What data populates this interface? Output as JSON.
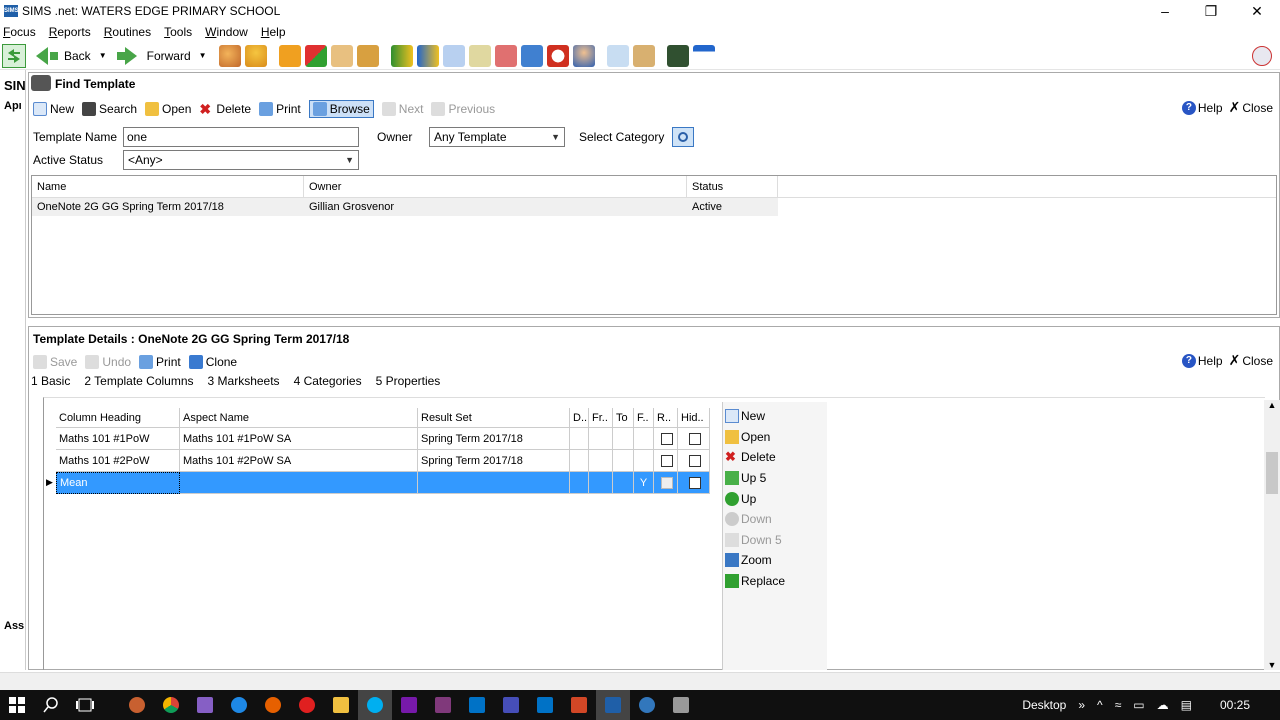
{
  "window": {
    "title": "SIMS .net: WATERS EDGE PRIMARY SCHOOL",
    "icon_text": "SIMS"
  },
  "window_controls": {
    "minimize": "–",
    "restore": "❐",
    "close": "✕"
  },
  "menu": [
    "Focus",
    "Reports",
    "Routines",
    "Tools",
    "Window",
    "Help"
  ],
  "main_toolbar": {
    "back": "Back",
    "forward": "Forward"
  },
  "left_strip": {
    "a": "SIN",
    "b": "Apı",
    "c": "Ass"
  },
  "find_template": {
    "title": "Find Template",
    "toolbar": {
      "new": "New",
      "search": "Search",
      "open": "Open",
      "delete": "Delete",
      "print": "Print",
      "browse": "Browse",
      "next": "Next",
      "previous": "Previous"
    },
    "help": "Help",
    "close": "Close",
    "template_name_label": "Template Name",
    "template_name_value": "one",
    "owner_label": "Owner",
    "owner_value": "Any Template",
    "select_category_label": "Select Category",
    "active_status_label": "Active Status",
    "active_status_value": "<Any>",
    "results": {
      "headers": [
        "Name",
        "Owner",
        "Status"
      ],
      "rows": [
        {
          "name": "OneNote 2G GG Spring Term 2017/18",
          "owner": "Gillian Grosvenor",
          "status": "Active"
        }
      ]
    }
  },
  "template_details": {
    "title": "Template Details : OneNote 2G GG Spring Term 2017/18",
    "toolbar": {
      "save": "Save",
      "undo": "Undo",
      "print": "Print",
      "clone": "Clone"
    },
    "help": "Help",
    "close": "Close",
    "tabs": [
      "1 Basic",
      "2 Template Columns",
      "3 Marksheets",
      "4 Categories",
      "5 Properties"
    ],
    "grid": {
      "headers": [
        "Column Heading",
        "Aspect Name",
        "Result Set",
        "D..",
        "Fr..",
        "To",
        "F..",
        "R..",
        "Hid.."
      ],
      "rows": [
        {
          "heading": "Maths 101 #1PoW",
          "aspect": "Maths 101 #1PoW SA",
          "result_set": "Spring Term 2017/18",
          "d": "",
          "fr": "",
          "to": "",
          "f": ""
        },
        {
          "heading": "Maths 101 #2PoW",
          "aspect": "Maths 101 #2PoW SA",
          "result_set": "Spring Term 2017/18",
          "d": "",
          "fr": "",
          "to": "",
          "f": ""
        },
        {
          "heading": "Mean",
          "aspect": "",
          "result_set": "",
          "d": "",
          "fr": "",
          "to": "",
          "f": "Y"
        }
      ]
    },
    "side_actions": [
      "New",
      "Open",
      "Delete",
      "Up 5",
      "Up",
      "Down",
      "Down 5",
      "Zoom",
      "Replace"
    ]
  },
  "taskbar": {
    "desktop": "Desktop",
    "chevron": "»",
    "time": "00:25"
  }
}
